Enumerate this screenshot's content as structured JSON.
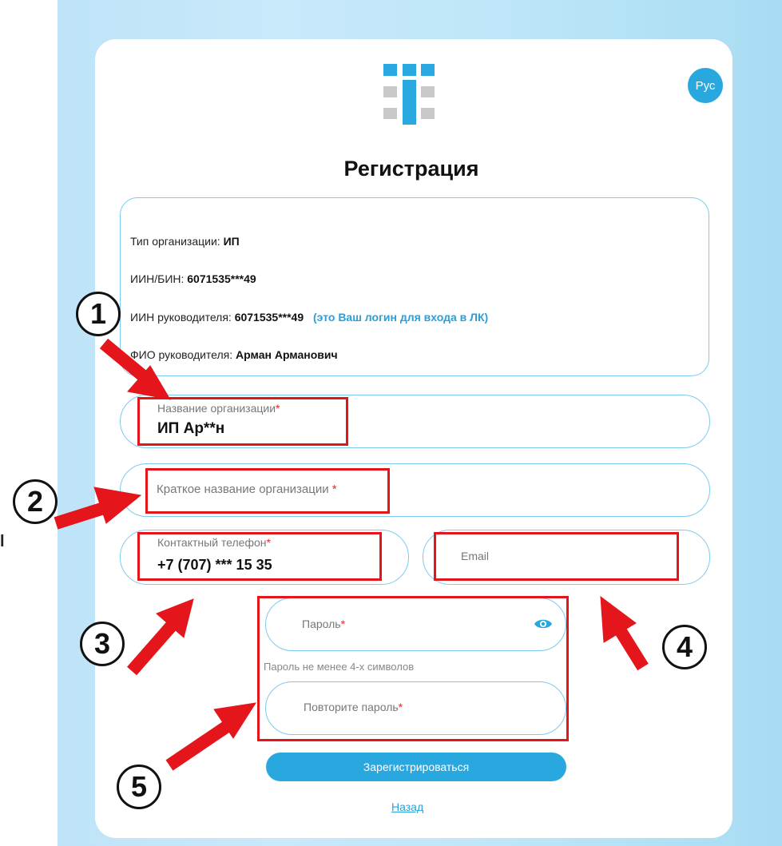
{
  "lang_button": "Рус",
  "page_title": "Регистрация",
  "info": {
    "org_type_label": "Тип организации:",
    "org_type_value": "ИП",
    "iin_bin_label": "ИИН/БИН:",
    "iin_bin_value": "6071535***49",
    "head_iin_label": "ИИН руководителя:",
    "head_iin_value": "6071535***49",
    "head_iin_hint": "(это Ваш логин для входа в ЛК)",
    "head_name_label": "ФИО руководителя:",
    "head_name_value": "Арман Арманович"
  },
  "form": {
    "org_name_label": "Название организации",
    "org_name_value": "ИП Ар**н",
    "short_name_label": "Краткое название организации ",
    "phone_label": "Контактный телефон",
    "phone_value": "+7 (707)  *** 15 35",
    "email_placeholder": "Email",
    "password_label": "Пароль",
    "password_hint": "Пароль не менее 4-х символов",
    "repeat_password_label": "Повторите пароль",
    "required_mark": "*",
    "submit_label": "Зарегистрироваться",
    "back_label": "Назад"
  },
  "annotations": {
    "badges": [
      "1",
      "2",
      "3",
      "4",
      "5"
    ],
    "highlight_color": "#e4161b"
  },
  "stray_text": "l",
  "colors": {
    "accent": "#29a8e0",
    "field_border": "#7ccbed",
    "required": "#e02a2a",
    "arrow": "#e4161b"
  },
  "icons": {
    "logo": "tiled-logo-icon",
    "password_toggle": "eye-icon"
  }
}
